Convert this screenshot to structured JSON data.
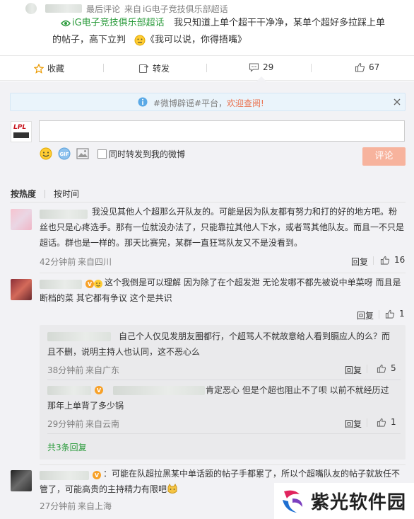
{
  "post": {
    "last_comment_label": "最后评论",
    "source_prefix": "来自",
    "source_name": "iG电子竞技俱乐部超话",
    "line1_rest": "我只知道上单个超干干净净，某单个超好多拉踩上单",
    "line2": "的帖子，高下立判",
    "line2_quote": "《我可以说，你得捂嘴》"
  },
  "actions": {
    "favorite": "收藏",
    "repost": "转发",
    "comment_count": "29",
    "like_count": "67"
  },
  "notice": {
    "prefix": "#微博辟谣#平台，",
    "link": "欢迎查阅!"
  },
  "composer": {
    "input_value": "",
    "sync_label": "同时转发到我的微博",
    "submit_label": "评论",
    "avatar_text": "LPL"
  },
  "sort": {
    "by_hot": "按热度",
    "by_time": "按时间"
  },
  "reply_label": "回复",
  "comments": [
    {
      "text": "我没见其他人个超那么开队友的。可能是因为队友都有努力和打的好的地方吧。粉丝也只是心疼选手。那有一位就没办法了，只能靠拉其他人下水，或者骂其他队友。而且一不只是超话。群也是一样的。那天比赛完，某群一直狂骂队友又不是没看到。",
      "lines": [
        "我没见其他人个超那么开队友的。可能是因为队友都有努力和打的好的地方吧。粉",
        "丝也只是心疼选手。那有一位就没办法了，只能靠拉其他人下水，或者骂其他队友。而且一不只是",
        "超话。群也是一样的。那天比赛完，某群一直狂骂队友又不是没看到。"
      ],
      "time": "42分钟前",
      "location": "来自四川",
      "likes": "16"
    },
    {
      "lines": [
        "这个我倒是可以理解 因为除了在个超发泄 无论发哪不都先被说中单菜呀 而且是",
        "断档的菜 其它都有争议 这个是共识"
      ],
      "time": "",
      "location": "",
      "likes": "1"
    },
    {
      "lines": [
        "自己个人仅见发朋友圈都行，个超骂人不就故意给人看到膈应人的么？而",
        "且不删，说明主持人也认同，这不恶心么"
      ],
      "time": "38分钟前",
      "location": "来自广东",
      "likes": "5"
    },
    {
      "lines": [
        "肯定恶心 但是个超也阻止不了呗 以前不就经历过",
        "那年上单背了多少锅"
      ],
      "time": "29分钟前",
      "location": "来自云南",
      "likes": "1"
    },
    {
      "lines": [
        "：可能在队超拉黑某中单话题的帖子手都累了，所以个超嘴队友的帖子就放任不",
        "管了，可能高贵的主持精力有限吧"
      ],
      "time": "27分钟前",
      "location": "来自上海",
      "likes": ""
    }
  ],
  "replies_total": "共3条回复",
  "watermark": "紫光软件园",
  "colors": {
    "accent": "#eb7350",
    "superTopic": "#2a9b3b",
    "submit_bg": "#f7b39d"
  }
}
